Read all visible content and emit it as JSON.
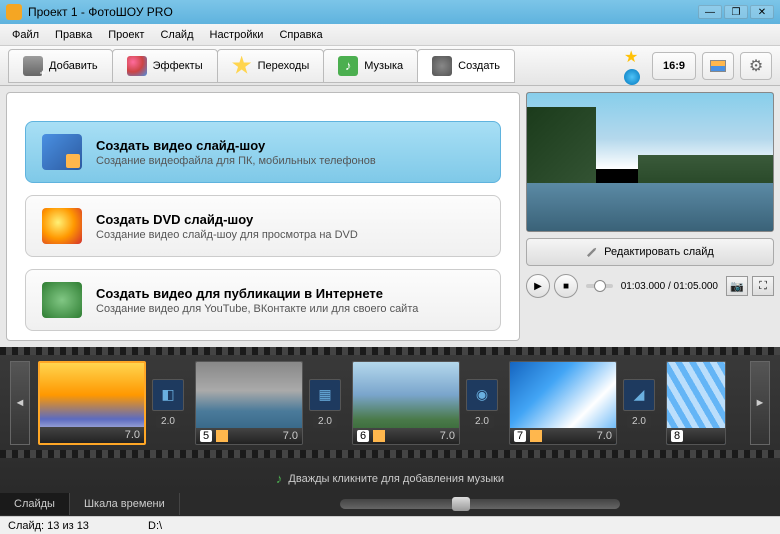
{
  "window": {
    "title": "Проект 1 - ФотоШОУ PRO"
  },
  "menu": [
    "Файл",
    "Правка",
    "Проект",
    "Слайд",
    "Настройки",
    "Справка"
  ],
  "tabs": {
    "add": "Добавить",
    "fx": "Эффекты",
    "trans": "Переходы",
    "music": "Музыка",
    "create": "Создать"
  },
  "toolbar": {
    "aspect": "16:9"
  },
  "options": [
    {
      "title": "Создать видео слайд-шоу",
      "desc": "Создание видеофайла для ПК, мобильных телефонов"
    },
    {
      "title": "Создать DVD слайд-шоу",
      "desc": "Создание видео слайд-шоу для просмотра на DVD"
    },
    {
      "title": "Создать видео для публикации в Интернете",
      "desc": "Создание видео для YouTube, ВКонтакте или для своего сайта"
    }
  ],
  "preview": {
    "edit": "Редактировать слайд",
    "time": "01:03.000 / 01:05.000"
  },
  "timeline": {
    "slides": [
      {
        "num": "",
        "dur": "7.0",
        "trans": "2.0"
      },
      {
        "num": "5",
        "dur": "7.0",
        "trans": "2.0"
      },
      {
        "num": "6",
        "dur": "7.0",
        "trans": "2.0"
      },
      {
        "num": "7",
        "dur": "7.0",
        "trans": "2.0"
      },
      {
        "num": "8",
        "dur": ""
      }
    ],
    "musicHint": "Дважды кликните для добавления музыки",
    "tabs": {
      "slides": "Слайды",
      "scale": "Шкала времени"
    }
  },
  "status": {
    "count": "Слайд: 13 из 13",
    "path": "D:\\"
  }
}
